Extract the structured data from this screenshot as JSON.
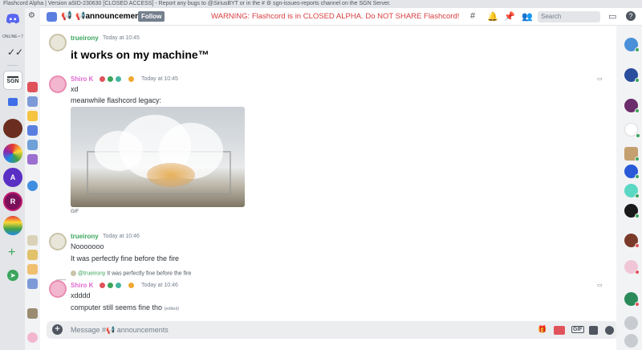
{
  "window": {
    "title": "Flashcord Alpha | Version aSID-230630 [CLOSED ACCESS] - Report any bugs to @SiriusBYT or in the # ⚙ sgn-issues-reports channel on the SGN Server."
  },
  "rail": {
    "online_count": "ONLINE • 7",
    "servers": [
      {
        "name": "SGN",
        "color": "#ffffff"
      },
      {
        "name": "",
        "color": "#3f6ee8"
      },
      {
        "name": "",
        "color": "#6b2d1f"
      },
      {
        "name": "",
        "color": "#d94a8c"
      },
      {
        "name": "A",
        "color": "#5a2fc4"
      },
      {
        "name": "R",
        "color": "#7a0f5a"
      },
      {
        "name": "",
        "color": "#e8a23a"
      }
    ]
  },
  "header": {
    "channel_name": "📢announcements",
    "follow_label": "Follow",
    "warning": "WARNING: Flashcord is in CLOSED ALPHA. Do NOT SHARE Flashcord!",
    "search_placeholder": "Search"
  },
  "messages": [
    {
      "author": "trueirony",
      "time": "Today at 10:45",
      "text": "it works on my machine™"
    },
    {
      "author": "Shiro K",
      "time": "Today at 10:45",
      "lines": [
        "xd",
        "meanwhile flashcord legacy:"
      ],
      "attachment_label": "GIF"
    },
    {
      "author": "trueirony",
      "time": "Today at 10:46",
      "lines": [
        "Nooooooo",
        "It was perfectly fine before the fire"
      ]
    },
    {
      "reply_author": "@trueirony",
      "reply_text": "It was perfectly fine before the fire",
      "author": "Shiro K",
      "time": "Today at 10:46",
      "lines": [
        "xdddd",
        "computer still seems fine tho"
      ],
      "edited": "(edited)"
    }
  ],
  "composer": {
    "placeholder": "Message #📢 announcements",
    "gif_label": "GIF"
  },
  "colors": {
    "warning": "#d83c3e",
    "green_name": "#3ba55d",
    "pink_name": "#e06ad0",
    "follow_button": "#747f8d"
  }
}
